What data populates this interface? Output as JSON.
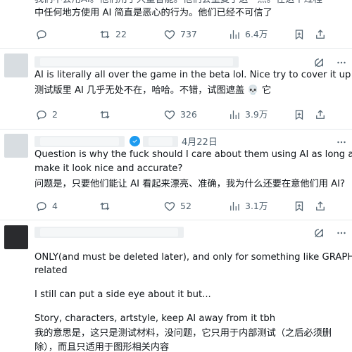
{
  "top_post": {
    "line_1": "我们不会用AI。”他们用了大量智能。”他们会重复了这一点。在这个过程",
    "line_2": "中任何地方使用 AI 简直是恶心的行为。他们已经不可信了",
    "reply_count": "",
    "repost_count": "22",
    "like_count": "737",
    "view_count": "6.4万"
  },
  "post_1": {
    "text_en": "AI is literally all over the game in the beta lol. Nice try to cover it up💀",
    "text_zh": "测试版里 AI 几乎无处不在，哈哈。不错，试图遮盖 💀 它",
    "reply_count": "2",
    "repost_count": "",
    "like_count": "326",
    "view_count": "3.9万"
  },
  "post_2": {
    "date": "4月22日",
    "text_en_line_1": "Question is why the fuck should I care about them using AI as long as they",
    "text_en_line_2": "make it look nice and accurate?",
    "text_zh": "问题是，只要他们能让 AI 看起来漂亮、准确，我为什么还要在意他们用 AI?",
    "reply_count": "4",
    "repost_count": "",
    "like_count": "52",
    "view_count": "3.1万"
  },
  "post_3": {
    "text_en_line_1": "ONLY(and must be deleted later), and only for something like GRAPHICS",
    "text_en_line_2": "related",
    "text_en_line_3": "I still can put a side eye about it but...",
    "text_en_line_4": "Story, characters, artstyle, keep AI away from it tbh",
    "text_zh_line_1": "我的意思是，这只是测试材料，没问题，它只用于内部测试（之后必须删",
    "text_zh_line_2": "除），而且只适用于图形相关内容"
  },
  "icons": {
    "reply": "reply-icon",
    "repost": "repost-icon",
    "like": "heart-icon",
    "views": "views-icon",
    "bookmark": "bookmark-icon",
    "share": "share-icon",
    "grok": "grok-icon",
    "more": "more-icon",
    "verified": "verified-badge"
  },
  "colors": {
    "text": "#0f1419",
    "muted": "#536471",
    "accent": "#1d9bf0",
    "divider": "#e6e9ec"
  }
}
